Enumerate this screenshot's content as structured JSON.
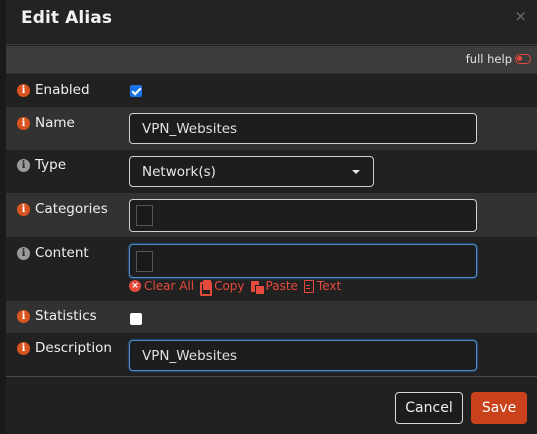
{
  "dialog": {
    "title": "Edit Alias",
    "close_glyph": "×"
  },
  "help": {
    "label": "full help",
    "toggle_icon": "toggle-off-icon",
    "toggle_color": "#e04a3f"
  },
  "fields": {
    "enabled": {
      "label": "Enabled",
      "checked": true
    },
    "name": {
      "label": "Name",
      "value": "VPN_Websites"
    },
    "type": {
      "label": "Type",
      "value": "Network(s)"
    },
    "categories": {
      "label": "Categories",
      "value": ""
    },
    "content": {
      "label": "Content",
      "value": "",
      "actions": {
        "clear": "Clear All",
        "copy": "Copy",
        "paste": "Paste",
        "text": "Text"
      }
    },
    "statistics": {
      "label": "Statistics",
      "checked": false
    },
    "description": {
      "label": "Description",
      "value": "VPN_Websites"
    }
  },
  "info_glyph": "i",
  "buttons": {
    "cancel": "Cancel",
    "save": "Save"
  },
  "colors": {
    "accent": "#d9531e",
    "save_button": "#c9421c",
    "action_text": "#e54b3c",
    "focus_border": "#4a8fd6"
  }
}
